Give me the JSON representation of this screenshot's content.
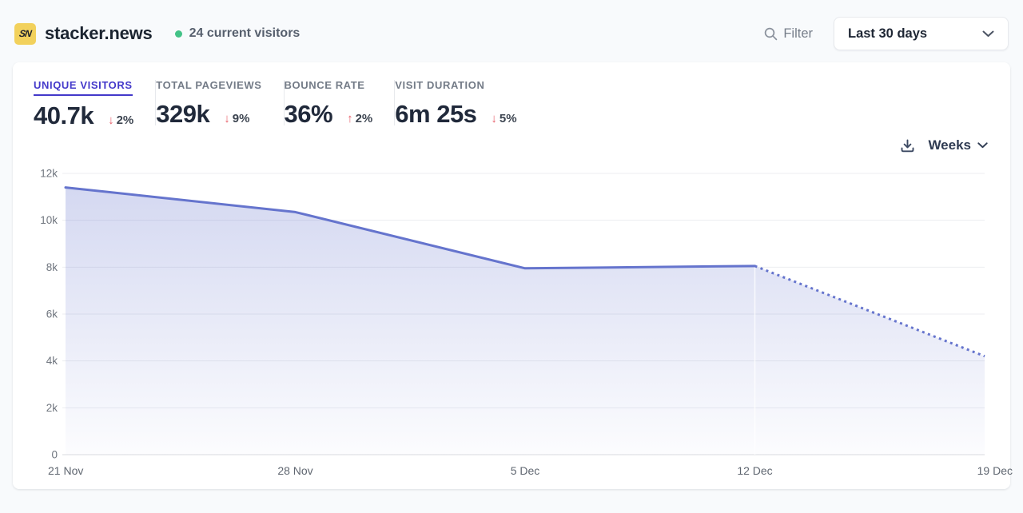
{
  "header": {
    "logo_text": "SN",
    "site_name": "stacker.news",
    "current_visitors": "24 current visitors",
    "filter_label": "Filter",
    "date_range": "Last 30 days"
  },
  "stats": [
    {
      "label": "UNIQUE VISITORS",
      "value": "40.7k",
      "arrow": "↓",
      "change": "2%",
      "active": true
    },
    {
      "label": "TOTAL PAGEVIEWS",
      "value": "329k",
      "arrow": "↓",
      "change": "9%",
      "active": false
    },
    {
      "label": "BOUNCE RATE",
      "value": "36%",
      "arrow": "↑",
      "change": "2%",
      "active": false
    },
    {
      "label": "VISIT DURATION",
      "value": "6m 25s",
      "arrow": "↓",
      "change": "5%",
      "active": false
    }
  ],
  "toolbar": {
    "interval_label": "Weeks"
  },
  "colors": {
    "accent_indigo": "#4338ca",
    "line": "#6574cd",
    "fill_top": "rgba(101,116,205,0.28)",
    "fill_bottom": "rgba(101,116,205,0.02)",
    "negative_red": "#e8606b",
    "visitors_dot_green": "#43c287",
    "grid": "#ecedf0",
    "baseline": "#d9dbdf"
  },
  "chart_data": {
    "type": "area",
    "title": "Unique visitors by week",
    "x": [
      "21 Nov",
      "28 Nov",
      "5 Dec",
      "12 Dec",
      "19 Dec"
    ],
    "series": [
      {
        "name": "Unique visitors",
        "values": [
          11400,
          10350,
          7950,
          8050,
          4200
        ]
      }
    ],
    "dashed_from_index": 3,
    "ylim": [
      0,
      12000
    ],
    "yticks": [
      0,
      2000,
      4000,
      6000,
      8000,
      10000,
      12000
    ],
    "ytick_labels": [
      "0",
      "2k",
      "4k",
      "6k",
      "8k",
      "10k",
      "12k"
    ],
    "xlabel": "",
    "ylabel": "",
    "grid": "horizontal",
    "legend": "none"
  }
}
